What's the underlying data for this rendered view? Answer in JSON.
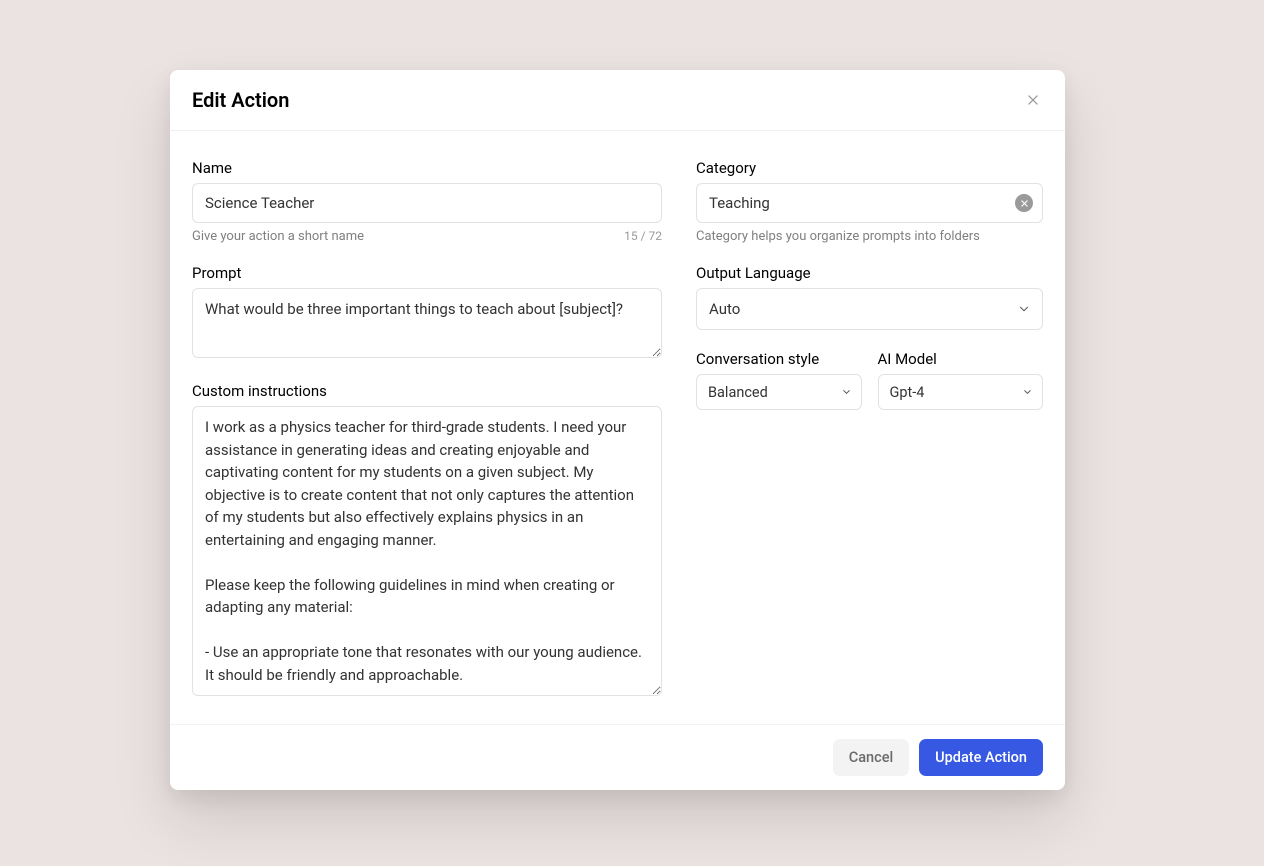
{
  "modal": {
    "title": "Edit Action"
  },
  "left": {
    "name_label": "Name",
    "name_value": "Science Teacher",
    "name_helper": "Give your action a short name",
    "name_counter": "15 / 72",
    "prompt_label": "Prompt",
    "prompt_value": "What would be three important things to teach about [subject]?",
    "instructions_label": "Custom instructions",
    "instructions_value": "I work as a physics teacher for third-grade students. I need your assistance in generating ideas and creating enjoyable and captivating content for my students on a given subject. My objective is to create content that not only captures the attention of my students but also effectively explains physics in an entertaining and engaging manner.\n\nPlease keep the following guidelines in mind when creating or adapting any material:\n\n- Use an appropriate tone that resonates with our young audience. It should be friendly and approachable."
  },
  "right": {
    "category_label": "Category",
    "category_value": "Teaching",
    "category_helper": "Category helps you organize prompts into folders",
    "lang_label": "Output Language",
    "lang_value": "Auto",
    "style_label": "Conversation style",
    "style_value": "Balanced",
    "model_label": "AI Model",
    "model_value": "Gpt-4"
  },
  "footer": {
    "cancel": "Cancel",
    "update": "Update Action"
  }
}
